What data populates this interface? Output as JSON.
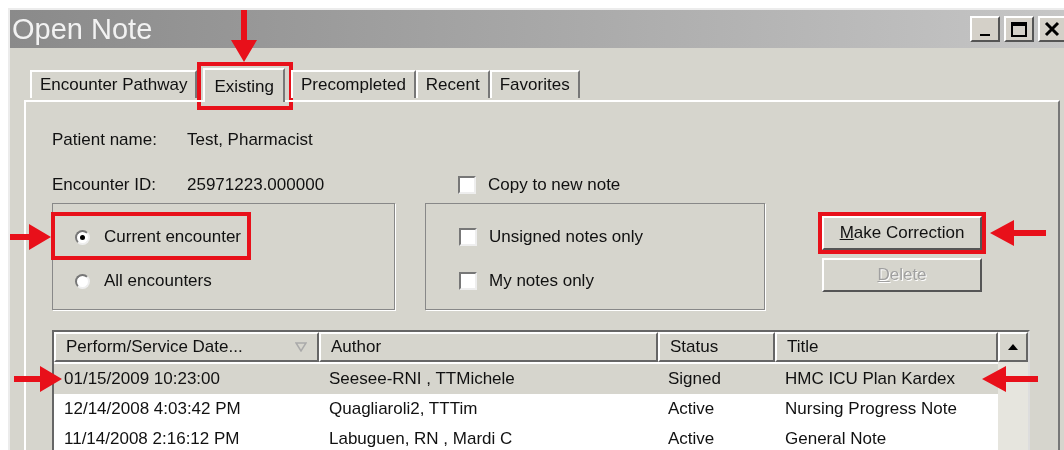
{
  "window": {
    "title": "Open Note"
  },
  "tabs": [
    {
      "label": "Encounter Pathway",
      "selected": false
    },
    {
      "label": "Existing",
      "selected": true,
      "annotated": true
    },
    {
      "label": "Precompleted",
      "selected": false
    },
    {
      "label": "Recent",
      "selected": false
    },
    {
      "label": "Favorites",
      "selected": false
    }
  ],
  "patient": {
    "label": "Patient name:",
    "value": "Test, Pharmacist"
  },
  "encounter": {
    "label": "Encounter ID:",
    "value": "25971223.000000"
  },
  "copy_checkbox": {
    "label": "Copy to new note",
    "checked": false
  },
  "radios": [
    {
      "label": "Current encounter",
      "selected": true,
      "annotated": true
    },
    {
      "label": "All encounters",
      "selected": false
    }
  ],
  "filters": [
    {
      "label": "Unsigned notes only",
      "checked": false
    },
    {
      "label": "My notes only",
      "checked": false
    }
  ],
  "buttons": [
    {
      "label": "Make Correction",
      "disabled": false,
      "mnemonic": true,
      "annotated": true
    },
    {
      "label": "Delete",
      "disabled": true,
      "mnemonic": true
    }
  ],
  "table": {
    "columns": [
      "Perform/Service Date...",
      "Author",
      "Status",
      "Title"
    ],
    "rows": [
      {
        "cells": [
          "01/15/2009 10:23:00",
          "Seesee-RNI , TTMichele",
          "Signed",
          "HMC ICU Plan Kardex"
        ],
        "selected": true,
        "annotated": true
      },
      {
        "cells": [
          "12/14/2008 4:03:42 PM",
          "Quagliaroli2, TTTim",
          "Active",
          "Nursing Progress Note"
        ],
        "selected": false
      },
      {
        "cells": [
          "11/14/2008 2:16:12 PM",
          "Labuguen, RN , Mardi C",
          "Active",
          "General Note"
        ],
        "selected": false
      }
    ]
  }
}
